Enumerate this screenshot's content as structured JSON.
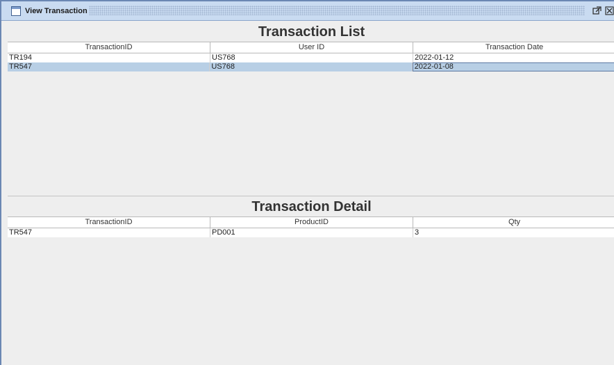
{
  "window": {
    "title": "View Transaction"
  },
  "transaction_list": {
    "title": "Transaction List",
    "columns": [
      "TransactionID",
      "User ID",
      "Transaction Date"
    ],
    "rows": [
      [
        "TR194",
        "US768",
        "2022-01-12"
      ],
      [
        "TR547",
        "US768",
        "2022-01-08"
      ]
    ],
    "selected_row": 1
  },
  "transaction_detail": {
    "title": "Transaction Detail",
    "columns": [
      "TransactionID",
      "ProductID",
      "Qty"
    ],
    "rows": [
      [
        "TR547",
        "PD001",
        "3"
      ]
    ]
  },
  "colors": {
    "titlebar": "#c9dbf1",
    "selection": "#b8cfe5",
    "background": "#eeeeee"
  }
}
